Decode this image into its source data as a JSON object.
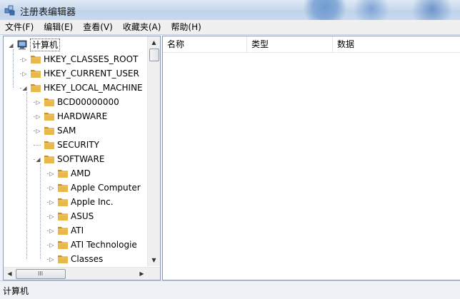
{
  "window": {
    "title": "注册表编辑器"
  },
  "menu": [
    "文件(F)",
    "编辑(E)",
    "查看(V)",
    "收藏夹(A)",
    "帮助(H)"
  ],
  "list_columns": [
    "名称",
    "类型",
    "数据"
  ],
  "tree": [
    {
      "label": "计算机",
      "icon": "computer-icon",
      "expander": "expanded"
    },
    {
      "label": "HKEY_CLASSES_ROOT",
      "icon": "folder-icon",
      "expander": "collapsed"
    },
    {
      "label": "HKEY_CURRENT_USER",
      "icon": "folder-icon",
      "expander": "collapsed"
    },
    {
      "label": "HKEY_LOCAL_MACHINE",
      "icon": "folder-icon",
      "expander": "expanded"
    },
    {
      "label": "BCD00000000",
      "icon": "folder-icon",
      "expander": "collapsed"
    },
    {
      "label": "HARDWARE",
      "icon": "folder-icon",
      "expander": "collapsed"
    },
    {
      "label": "SAM",
      "icon": "folder-icon",
      "expander": "collapsed"
    },
    {
      "label": "SECURITY",
      "icon": "folder-icon",
      "expander": "none"
    },
    {
      "label": "SOFTWARE",
      "icon": "folder-icon",
      "expander": "expanded"
    },
    {
      "label": "AMD",
      "icon": "folder-icon",
      "expander": "collapsed"
    },
    {
      "label": "Apple Computer",
      "icon": "folder-icon",
      "expander": "collapsed"
    },
    {
      "label": "Apple Inc.",
      "icon": "folder-icon",
      "expander": "collapsed"
    },
    {
      "label": "ASUS",
      "icon": "folder-icon",
      "expander": "collapsed"
    },
    {
      "label": "ATI",
      "icon": "folder-icon",
      "expander": "collapsed"
    },
    {
      "label": "ATI Technologie",
      "icon": "folder-icon",
      "expander": "collapsed"
    },
    {
      "label": "Classes",
      "icon": "folder-icon",
      "expander": "collapsed"
    }
  ],
  "scrollbar_glyph": "III",
  "status": {
    "path": "计算机"
  },
  "colors": {
    "folder": "#e8b84a",
    "folder_dark": "#c8922a",
    "border": "#8e9bb0"
  }
}
